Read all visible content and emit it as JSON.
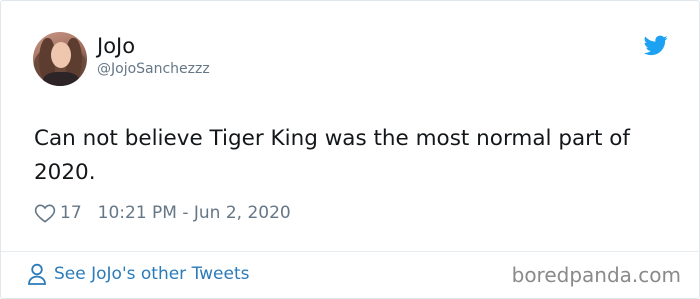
{
  "author": {
    "display_name": "JoJo",
    "handle": "@JojoSanchezzz"
  },
  "tweet": {
    "text": "Can not believe Tiger King was the most normal part of 2020.",
    "likes": "17",
    "timestamp": "10:21 PM - Jun 2, 2020"
  },
  "footer": {
    "see_more_label": "See JoJo's other Tweets",
    "watermark": "boredpanda.com"
  },
  "icons": {
    "brand": "twitter-bird-icon",
    "like": "heart-icon",
    "profile": "person-icon"
  },
  "colors": {
    "twitter_blue": "#1da1f2",
    "link_blue": "#2b7bb9",
    "text": "#14171a",
    "muted": "#657786"
  }
}
